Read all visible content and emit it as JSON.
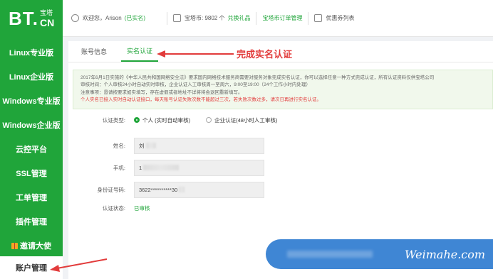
{
  "logo": {
    "bt": "BT.",
    "cn_top": "宝塔",
    "cn_bottom": "CN"
  },
  "sidebar": {
    "items": [
      {
        "label": "Linux专业版"
      },
      {
        "label": "Linux企业版"
      },
      {
        "label": "Windows专业版"
      },
      {
        "label": "Windows企业版"
      },
      {
        "label": "云控平台"
      },
      {
        "label": "SSL管理"
      },
      {
        "label": "工单管理"
      },
      {
        "label": "插件管理"
      },
      {
        "label": "邀请大使"
      }
    ],
    "active_label": "账户管理"
  },
  "topbar": {
    "welcome": "欢迎您，Arison",
    "verified": "(已实名)",
    "coin_label": "宝塔币: 9802 个",
    "coin_action": "兑换礼品",
    "orders": "宝塔币订单管理",
    "coupons": "优惠券列表"
  },
  "tabs": {
    "account": "账号信息",
    "realname": "实名认证"
  },
  "annotation": {
    "text": "完成实名认证",
    "color": "#e23b3b"
  },
  "notice": {
    "line1": "2017年6月1日实施的《中华人民共和国网络安全法》要求国内网络技术服务商需要对服务对象完成实名认证，你可以选择任意一种方式完成认证，所有认证资料仅供宝塔公司",
    "line2": "审核时间：个人审核24小时自动实时审核，企业认证人工审核周一至周六，9:00至19:00（24个工作小时内处理）",
    "line3": "注意事项：恳请按要求如实填写，存在虚假或者地址不详将将会退回重新填写。",
    "line4": "个人实名已接入实时自动认证接口，每天账号认证失败次数不能超过三次，若失败次数过多，请次日再进行实名认证。"
  },
  "form": {
    "type_label": "认证类型:",
    "option_personal": "个人 (实时自动审核)",
    "option_company": "企业认证(48小时人工审核)",
    "name_label": "姓名:",
    "name_value": "刘",
    "phone_label": "手机:",
    "phone_value": "1",
    "id_label": "身份证号码:",
    "id_value": "3622**********30",
    "status_label": "认证状态:",
    "status_value": "已审核"
  },
  "watermark": {
    "text": "Weimahe.com"
  },
  "colors": {
    "brand": "#20a53a",
    "watermark_bg": "#3f86d4"
  }
}
